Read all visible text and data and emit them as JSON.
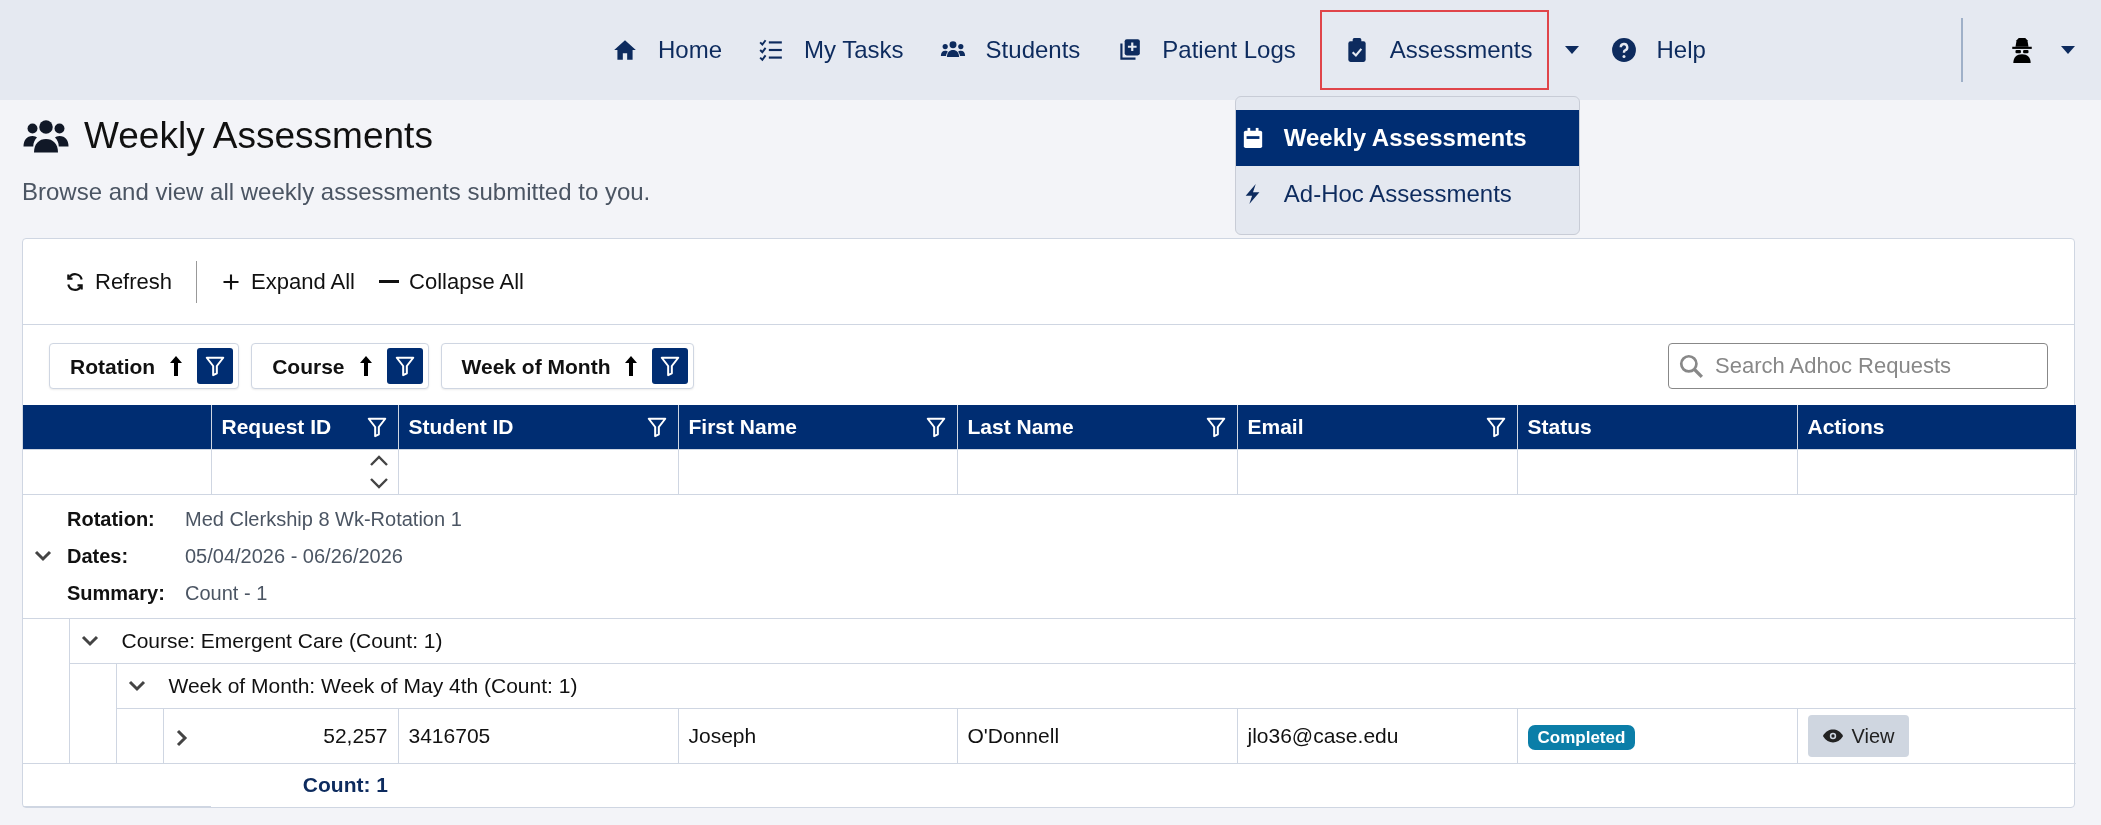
{
  "navbar": {
    "items": [
      {
        "label": "Home",
        "selected": false,
        "has_menu": false
      },
      {
        "label": "My Tasks",
        "selected": false,
        "has_menu": false
      },
      {
        "label": "Students",
        "selected": false,
        "has_menu": false
      },
      {
        "label": "Patient Logs",
        "selected": false,
        "has_menu": false
      },
      {
        "label": "Assessments",
        "selected": true,
        "has_menu": true,
        "expanded": true,
        "menu": [
          {
            "label": "Weekly Assessments",
            "selected": true
          },
          {
            "label": "Ad-Hoc Assessments",
            "selected": false
          }
        ]
      },
      {
        "label": "Help",
        "selected": false,
        "has_menu": false
      }
    ],
    "user_menu": {
      "expanded": false
    }
  },
  "page": {
    "title": "Weekly Assessments",
    "subtitle": "Browse and view all weekly assessments submitted to you."
  },
  "toolbar": {
    "buttons": [
      "Refresh",
      "Expand All",
      "Collapse All"
    ]
  },
  "group_chips": [
    {
      "label": "Rotation",
      "sort_ascending": true
    },
    {
      "label": "Course",
      "sort_ascending": true
    },
    {
      "label": "Week of Month",
      "sort_ascending": true
    }
  ],
  "search": {
    "placeholder": "Search Adhoc Requests"
  },
  "table": {
    "columns": [
      {
        "label": "Request ID",
        "filterable": true,
        "sortable": true
      },
      {
        "label": "Student ID",
        "filterable": true,
        "sortable": false
      },
      {
        "label": "First Name",
        "filterable": true,
        "sortable": false
      },
      {
        "label": "Last Name",
        "filterable": true,
        "sortable": false
      },
      {
        "label": "Email",
        "filterable": true,
        "sortable": false
      },
      {
        "label": "Status",
        "filterable": false,
        "sortable": false
      },
      {
        "label": "Actions",
        "filterable": false,
        "sortable": false
      }
    ],
    "groups": [
      {
        "expanded": true,
        "fields": [
          {
            "label": "Rotation:",
            "value": "Med Clerkship 8 Wk-Rotation 1"
          },
          {
            "label": "Dates:",
            "value": "05/04/2026 - 06/26/2026"
          },
          {
            "label": "Summary:",
            "value": "Count - 1"
          }
        ],
        "children": [
          {
            "label": "Course: Emergent Care (Count: 1)",
            "expanded": true,
            "children": [
              {
                "label": "Week of Month: Week of May 4th (Count: 1)",
                "expanded": true,
                "rows": [
                  {
                    "expanded": false,
                    "cells": [
                      "52,257",
                      "3416705",
                      "Joseph",
                      "O'Donnell",
                      "jlo36@case.edu"
                    ],
                    "status": "Completed",
                    "action": "View"
                  }
                ]
              }
            ]
          }
        ]
      }
    ],
    "footer": {
      "count": "Count: 1"
    }
  }
}
